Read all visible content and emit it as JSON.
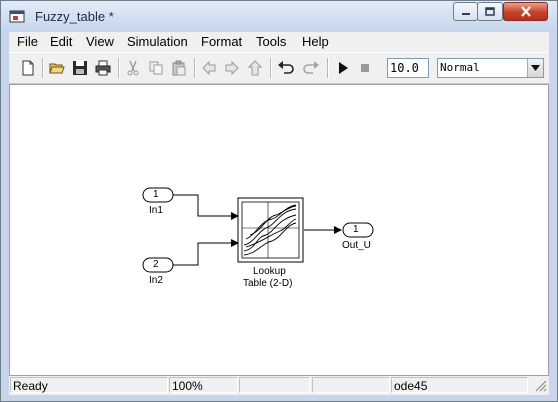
{
  "window": {
    "title": "Fuzzy_table *"
  },
  "menu": [
    "File",
    "Edit",
    "View",
    "Simulation",
    "Format",
    "Tools",
    "Help"
  ],
  "toolbar": {
    "stop_time": "10.0",
    "sim_mode": "Normal",
    "buttons": [
      "new-icon",
      "open-folder-icon",
      "save-icon",
      "print-icon",
      "cut-icon",
      "copy-icon",
      "paste-icon",
      "back-arrow-icon",
      "forward-arrow-icon",
      "up-arrow-icon",
      "undo-icon",
      "redo-icon",
      "play-icon",
      "stop-icon"
    ]
  },
  "model": {
    "inport1": {
      "number": "1",
      "name": "In1"
    },
    "inport2": {
      "number": "2",
      "name": "In2"
    },
    "lookup": {
      "line1": "Lookup",
      "line2": "Table (2-D)"
    },
    "outport": {
      "number": "1",
      "name": "Out_U"
    }
  },
  "status": {
    "state": "Ready",
    "zoom": "100%",
    "solver": "ode45"
  }
}
